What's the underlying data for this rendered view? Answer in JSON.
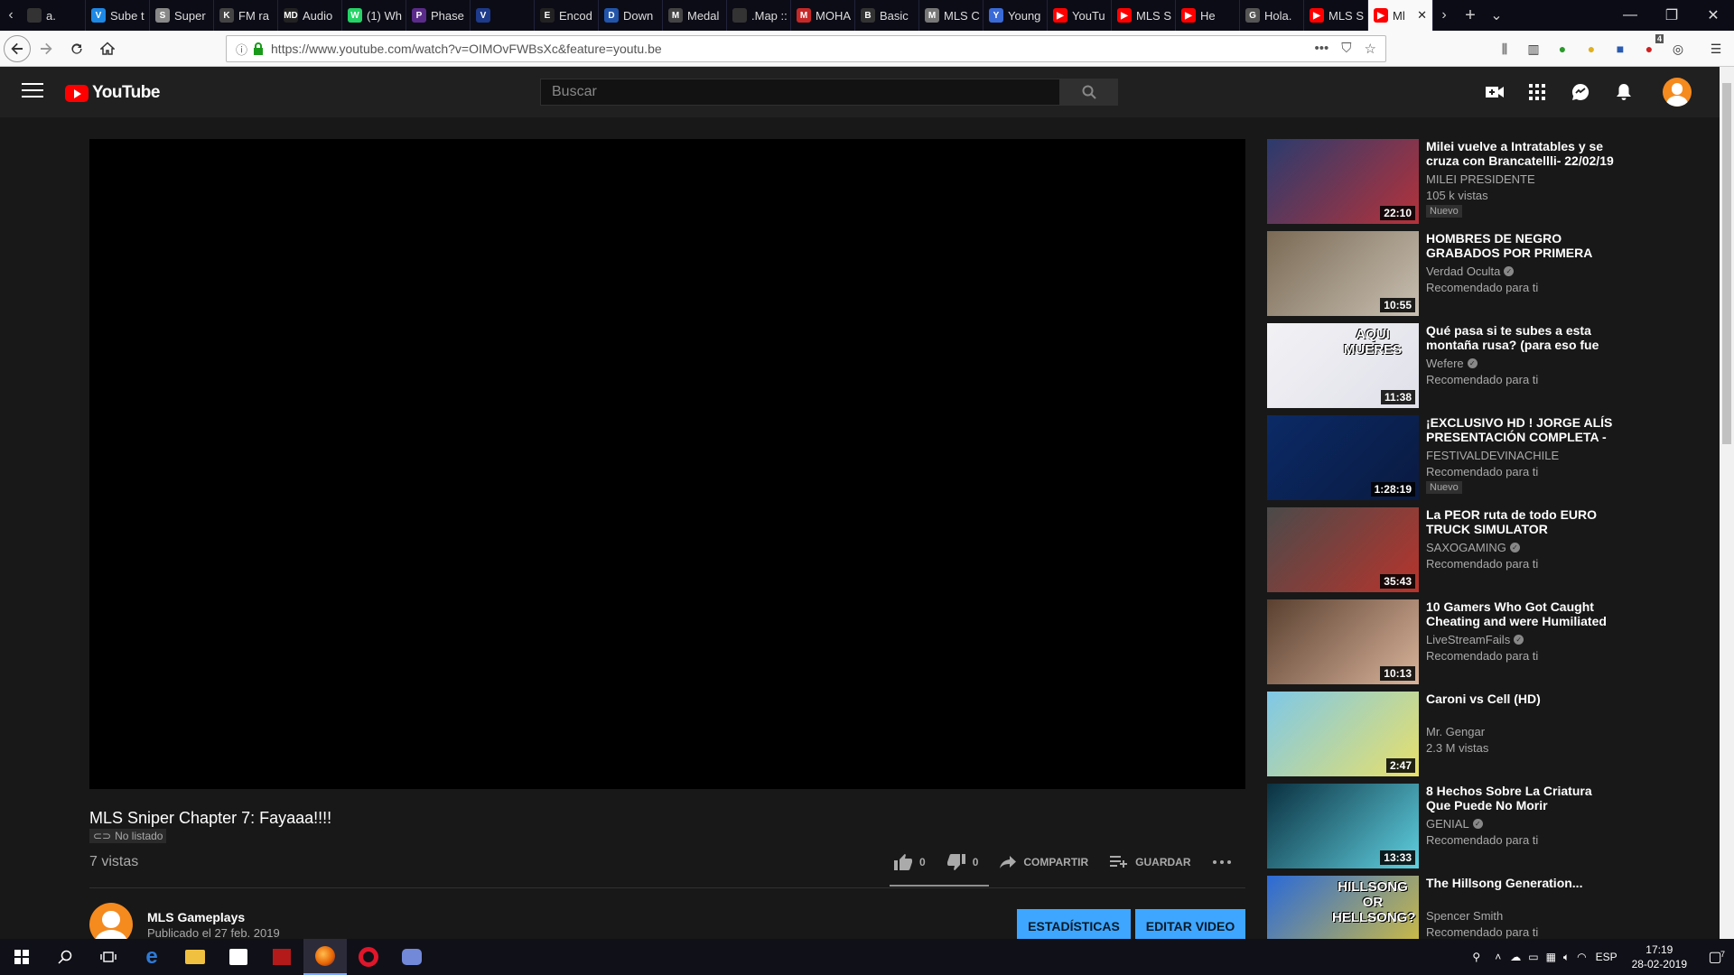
{
  "browser": {
    "tabs": [
      {
        "label": "a.",
        "color": "#333"
      },
      {
        "label": "Sube t",
        "color": "#1e88e5",
        "glyph": "V"
      },
      {
        "label": "Super",
        "color": "#888",
        "glyph": "S"
      },
      {
        "label": "FM ra",
        "color": "#444",
        "glyph": "K"
      },
      {
        "label": "Audio",
        "color": "#222",
        "glyph": "MD"
      },
      {
        "label": "(1) Wh",
        "color": "#25d366",
        "glyph": "W"
      },
      {
        "label": "Phase",
        "color": "#5b2b8a",
        "glyph": "P"
      },
      {
        "label": "",
        "color": "#1e3a8a",
        "glyph": "V"
      },
      {
        "label": "Encod",
        "color": "#222",
        "glyph": "E"
      },
      {
        "label": "Down",
        "color": "#2255aa",
        "glyph": "D"
      },
      {
        "label": "Medal",
        "color": "#444",
        "glyph": "M"
      },
      {
        "label": ".Map :: Mu",
        "color": "#333",
        "glyph": ""
      },
      {
        "label": "MOHA",
        "color": "#c62828",
        "glyph": "M"
      },
      {
        "label": "Basic",
        "color": "#333",
        "glyph": "B"
      },
      {
        "label": "MLS C",
        "color": "#777",
        "glyph": "M"
      },
      {
        "label": "Young",
        "color": "#3a6ad8",
        "glyph": "Y"
      },
      {
        "label": "YouTu",
        "color": "#ff0000",
        "glyph": "▶"
      },
      {
        "label": "MLS S",
        "color": "#ff0000",
        "glyph": "▶"
      },
      {
        "label": "He",
        "color": "#ff0000",
        "glyph": "▶"
      },
      {
        "label": "Hola.",
        "color": "#555",
        "glyph": "G"
      },
      {
        "label": "MLS S",
        "color": "#ff0000",
        "glyph": "▶"
      },
      {
        "label": "Ml",
        "color": "#ff0000",
        "glyph": "▶",
        "active": true
      }
    ],
    "url": "https://www.youtube.com/watch?v=OIMOvFWBsXc&feature=youtu.be"
  },
  "youtube": {
    "logo_text": "YouTube",
    "search_placeholder": "Buscar",
    "video": {
      "title": "MLS Sniper Chapter 7: Fayaaa!!!!",
      "unlisted": "No listado",
      "views": "7 vistas",
      "likes": "0",
      "dislikes": "0",
      "share_label": "COMPARTIR",
      "save_label": "GUARDAR",
      "channel": "MLS Gameplays",
      "published": "Publicado el 27 feb. 2019",
      "stats_button": "ESTADÍSTICAS",
      "edit_button": "EDITAR VIDEO"
    },
    "recommended": [
      {
        "title": "Milei vuelve a Intratables y se cruza con Brancatellli- 22/02/19",
        "channel": "MILEI PRESIDENTE",
        "verified": false,
        "meta": "105 k vistas",
        "badge": "Nuevo",
        "duration": "22:10",
        "thumb": [
          "#2a3b6e",
          "#b5323a"
        ]
      },
      {
        "title": "HOMBRES DE NEGRO GRABADOS POR PRIMERA VEZ",
        "channel": "Verdad Oculta",
        "verified": true,
        "meta": "Recomendado para ti",
        "badge": "",
        "duration": "10:55",
        "thumb": [
          "#7a6a55",
          "#c9c0b2"
        ]
      },
      {
        "title": "Qué pasa si te subes a esta montaña rusa? (para eso fue",
        "channel": "Wefere",
        "verified": true,
        "meta": "Recomendado para ti",
        "badge": "",
        "duration": "11:38",
        "thumb": [
          "#f2f2f5",
          "#e0e0ea"
        ],
        "thumb_text": "AQUI MUERES"
      },
      {
        "title": "¡EXCLUSIVO HD ! JORGE ALÍS PRESENTACIÓN COMPLETA -",
        "channel": "FESTIVALDEVINACHILE",
        "verified": false,
        "meta": "Recomendado para ti",
        "badge": "Nuevo",
        "duration": "1:28:19",
        "thumb": [
          "#0b2a66",
          "#0a1a40"
        ]
      },
      {
        "title": "La PEOR ruta de todo EURO TRUCK SIMULATOR",
        "channel": "SAXOGAMING",
        "verified": true,
        "meta": "Recomendado para ti",
        "badge": "",
        "duration": "35:43",
        "thumb": [
          "#4a4a4a",
          "#b8342c"
        ]
      },
      {
        "title": "10 Gamers Who Got Caught Cheating and were Humiliated",
        "channel": "LiveStreamFails",
        "verified": true,
        "meta": "Recomendado para ti",
        "badge": "",
        "duration": "10:13",
        "thumb": [
          "#5a4030",
          "#d9b39a"
        ]
      },
      {
        "title": "Caroni vs Cell (HD)",
        "channel": "Mr. Gengar",
        "verified": false,
        "meta": "2.3 M vistas",
        "badge": "",
        "duration": "2:47",
        "thumb": [
          "#7ec8e8",
          "#e8e06a"
        ]
      },
      {
        "title": "8 Hechos Sobre La Criatura Que Puede No Morir",
        "channel": "GENIAL",
        "verified": true,
        "meta": "Recomendado para ti",
        "badge": "",
        "duration": "13:33",
        "thumb": [
          "#0a3040",
          "#5fd0e0"
        ]
      },
      {
        "title": "The Hillsong Generation...",
        "channel": "Spencer Smith",
        "verified": false,
        "meta": "Recomendado para ti",
        "badge": "",
        "duration": "",
        "thumb": [
          "#2a6ad8",
          "#d8c03a"
        ],
        "thumb_text": "HILLSONG OR HELLSONG?"
      }
    ]
  },
  "taskbar": {
    "language": "ESP",
    "time": "17:19",
    "date": "28-02-2019",
    "notification_count": "7",
    "tab_counter": "4"
  },
  "colors": {
    "yt_bg": "#181818",
    "yt_header": "#202020",
    "accent_blue": "#3ea6ff",
    "yt_red": "#ff0000",
    "avatar_orange": "#f58a1f"
  }
}
